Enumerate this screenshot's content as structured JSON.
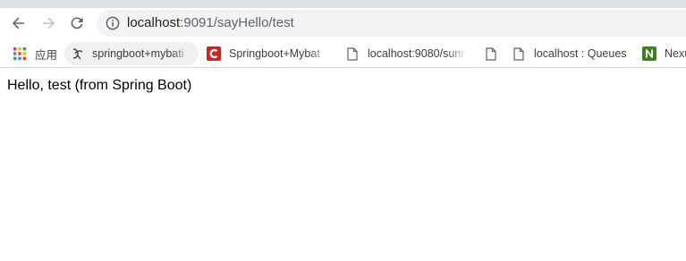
{
  "colors": {
    "tab_strip": "#dee1e6",
    "omnibox_bg": "#f1f3f4",
    "url_host": "#202124",
    "url_path": "#5f6368",
    "mybatis_icon_red": "#c62828",
    "nexus_icon_green": "#3f7f1f"
  },
  "toolbar": {
    "back_icon": "arrow-left-icon",
    "forward_icon": "arrow-right-icon",
    "reload_icon": "reload-icon"
  },
  "omnibox": {
    "info_icon": "info-icon",
    "host": "localhost",
    "path": ":9091/sayHello/test"
  },
  "bookmarks": {
    "apps_label": "应用",
    "items": [
      {
        "label": "springboot+mybati",
        "icon": "swirl-icon"
      },
      {
        "label": "Springboot+Mybat",
        "icon": "c-logo-icon"
      },
      {
        "label": "localhost:9080/sunr",
        "icon": "page-icon"
      },
      {
        "label": "",
        "icon": "page-icon"
      },
      {
        "label": "localhost : Queues",
        "icon": "page-icon"
      },
      {
        "label": "Nexu",
        "icon": "n-logo-icon"
      }
    ]
  },
  "page": {
    "message": "Hello, test (from Spring Boot)"
  }
}
